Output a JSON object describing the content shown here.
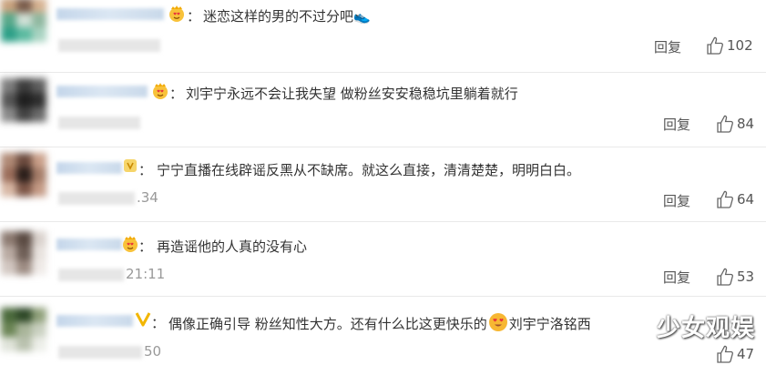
{
  "reply_label": "回复",
  "watermark": "少女观娱",
  "comments": [
    {
      "badge": "crown-heart-emoji",
      "colon": "：",
      "text": "迷恋这样的男的不过分吧👟",
      "time_visible": "",
      "likes": "102"
    },
    {
      "badge": "crown-heart-emoji",
      "colon": "：",
      "text": "刘宇宁永远不会让我失望  做粉丝安安稳稳坑里躺着就行",
      "time_visible": "",
      "likes": "84"
    },
    {
      "badge": "small-badge",
      "colon": "：",
      "text": "宁宁直播在线辟谣反黑从不缺席。就这么直接，清清楚楚，明明白白。",
      "time_visible": ".34",
      "likes": "64"
    },
    {
      "badge": "crown-heart-emoji",
      "colon": "：",
      "text": "再造谣他的人真的没有心",
      "time_visible": "21:11",
      "likes": "53"
    },
    {
      "badge": "check-v-icon",
      "colon": "：",
      "text_before_emoji": "偶像正确引导 粉丝知性大方。还有什么比这更快乐的",
      "emoji": "heart-eyes-emoji",
      "text_after_emoji": "刘宇宁洛铭西",
      "time_visible": "50",
      "likes": "47"
    }
  ],
  "colors": {
    "username_blur": "#c9d9ea",
    "text": "#333333",
    "meta": "#999999",
    "divider": "#e9e9e9"
  }
}
